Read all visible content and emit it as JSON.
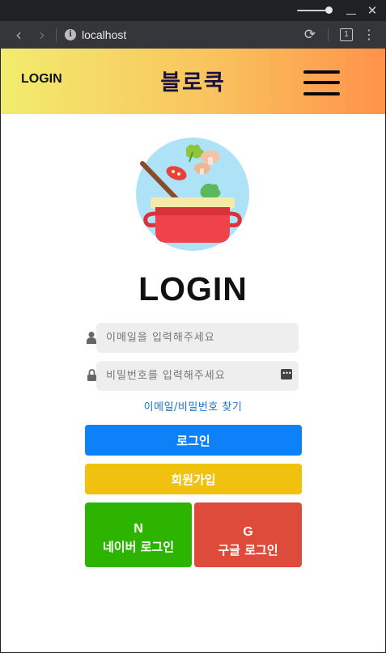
{
  "browser": {
    "url": "localhost",
    "tab_count": "1",
    "colors": {
      "titlebar": "#202124",
      "toolbar": "#35363a"
    }
  },
  "header": {
    "login_label": "LOGIN",
    "brand": "블로쿡",
    "menu_icon": "hamburger-icon",
    "gradient": [
      "#f2ec6e",
      "#f9c35e",
      "#ff924a"
    ]
  },
  "main": {
    "logo_icon": "cooking-pot-icon",
    "title": "LOGIN",
    "email": {
      "placeholder": "이메일을 입력해주세요",
      "value": "",
      "icon": "user-icon"
    },
    "password": {
      "placeholder": "비밀번호를 입력해주세요",
      "value": "",
      "icon": "lock-icon"
    },
    "find_link": "이메일/비밀번호 찾기",
    "buttons": {
      "login": {
        "label": "로그인",
        "color": "#0d82f8"
      },
      "signup": {
        "label": "회원가입",
        "color": "#f0c20f"
      },
      "naver": {
        "glyph": "N",
        "label": "네이버 로그인",
        "color": "#2db400"
      },
      "google": {
        "glyph": "G",
        "label": "구글 로그인",
        "color": "#df4b3b"
      }
    }
  }
}
